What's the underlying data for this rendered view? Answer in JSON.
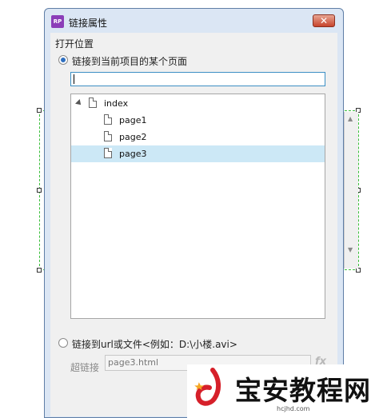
{
  "window": {
    "title": "链接属性",
    "app_icon_text": "RP",
    "close_glyph": "✕"
  },
  "open_location": {
    "label": "打开位置"
  },
  "option_page": {
    "label": "链接到当前项目的某个页面",
    "checked": true
  },
  "page_search": {
    "value": ""
  },
  "tree": {
    "root": {
      "label": "index",
      "expanded": true
    },
    "children": [
      {
        "label": "page1",
        "selected": false
      },
      {
        "label": "page2",
        "selected": false
      },
      {
        "label": "page3",
        "selected": true
      }
    ]
  },
  "option_url": {
    "label": "链接到url或文件<例如：D:\\小楼.avi>",
    "checked": false
  },
  "hyperlink": {
    "label": "超链接",
    "value": "page3.html",
    "fx_label": "fx"
  },
  "watermark": {
    "brand": "宝安教程网",
    "url": "hcjhd.com"
  }
}
